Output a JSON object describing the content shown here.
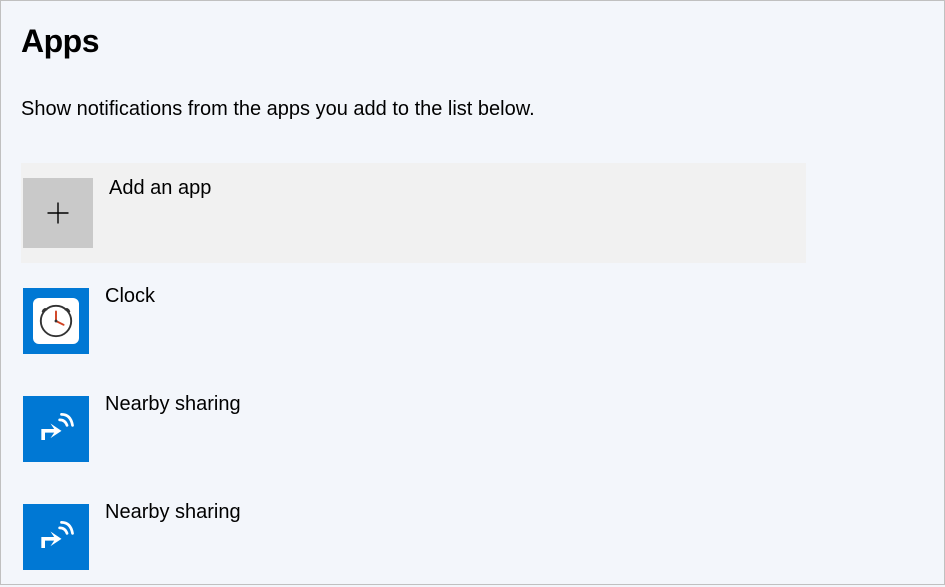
{
  "heading": "Apps",
  "description": "Show notifications from the apps you add to the list below.",
  "add_button_label": "Add an app",
  "apps": [
    {
      "label": "Clock",
      "icon": "clock"
    },
    {
      "label": "Nearby sharing",
      "icon": "nearby-sharing"
    },
    {
      "label": "Nearby sharing",
      "icon": "nearby-sharing"
    }
  ],
  "colors": {
    "accent": "#0078d4",
    "add_button_bg": "#c9c9c9",
    "panel_bg": "#f3f6fb",
    "hover_bg": "#f1f1f1"
  }
}
